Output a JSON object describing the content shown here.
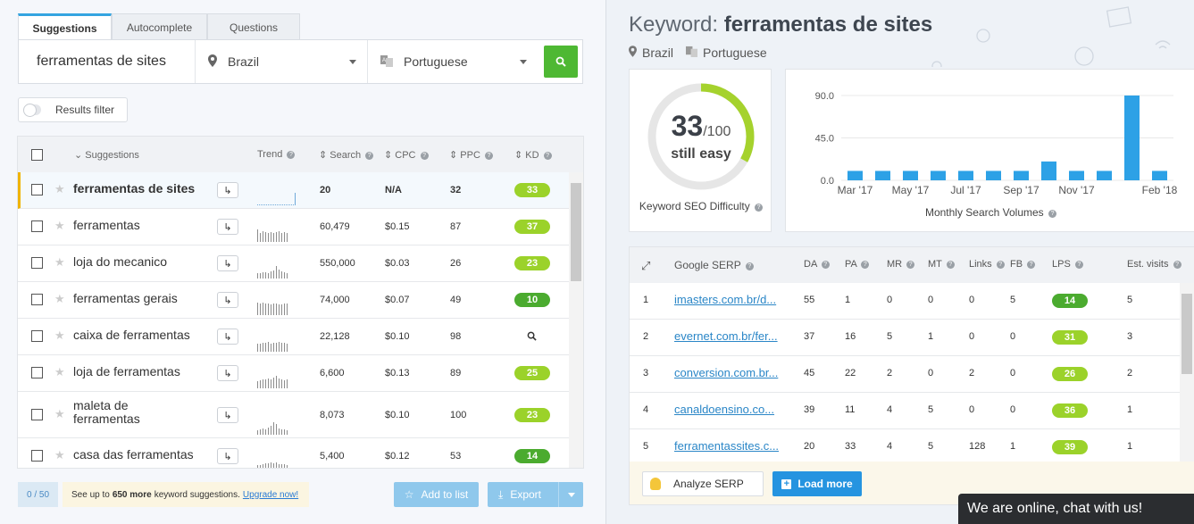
{
  "tabs": [
    "Suggestions",
    "Autocomplete",
    "Questions"
  ],
  "search": {
    "keyword": "ferramentas de sites",
    "location": "Brazil",
    "language": "Portuguese"
  },
  "filter_label": "Results filter",
  "columns": {
    "suggestions": "Suggestions",
    "trend": "Trend",
    "search": "Search",
    "cpc": "CPC",
    "ppc": "PPC",
    "kd": "KD"
  },
  "rows": [
    {
      "keyword": "ferramentas de sites",
      "search": "20",
      "cpc": "N/A",
      "ppc": "32",
      "kd": "33",
      "kd_color": "#9bd22a",
      "bold": true
    },
    {
      "keyword": "ferramentas",
      "search": "60,479",
      "cpc": "$0.15",
      "ppc": "87",
      "kd": "37",
      "kd_color": "#9bd22a"
    },
    {
      "keyword": "loja do mecanico",
      "search": "550,000",
      "cpc": "$0.03",
      "ppc": "26",
      "kd": "23",
      "kd_color": "#9bd22a"
    },
    {
      "keyword": "ferramentas gerais",
      "search": "74,000",
      "cpc": "$0.07",
      "ppc": "49",
      "kd": "10",
      "kd_color": "#4bab2f"
    },
    {
      "keyword": "caixa de ferramentas",
      "search": "22,128",
      "cpc": "$0.10",
      "ppc": "98",
      "kd": "",
      "kd_color": ""
    },
    {
      "keyword": "loja de ferramentas",
      "search": "6,600",
      "cpc": "$0.13",
      "ppc": "89",
      "kd": "25",
      "kd_color": "#9bd22a"
    },
    {
      "keyword": "maleta de ferramentas",
      "search": "8,073",
      "cpc": "$0.10",
      "ppc": "100",
      "kd": "23",
      "kd_color": "#9bd22a"
    },
    {
      "keyword": "casa das ferramentas",
      "search": "5,400",
      "cpc": "$0.12",
      "ppc": "53",
      "kd": "14",
      "kd_color": "#4bab2f"
    }
  ],
  "footer_left": {
    "counter": "0 / 50",
    "upsell_pre": "See up to",
    "upsell_bold": "650 more",
    "upsell_post": "keyword suggestions.",
    "upsell_link": "Upgrade now!",
    "add_to_list": "Add to list",
    "export": "Export"
  },
  "right": {
    "title_prefix": "Keyword:",
    "title_keyword": "ferramentas de sites",
    "location": "Brazil",
    "language": "Portuguese",
    "score": "33",
    "score_max": "/100",
    "score_label": "still easy",
    "score_caption": "Keyword SEO Difficulty",
    "volume_caption": "Monthly Search Volumes",
    "serp_header": {
      "google": "Google SERP",
      "da": "DA",
      "pa": "PA",
      "mr": "MR",
      "mt": "MT",
      "links": "Links",
      "fb": "FB",
      "lps": "LPS",
      "visits": "Est. visits"
    },
    "serp_rows": [
      {
        "n": "1",
        "url": "imasters.com.br/d...",
        "da": "55",
        "pa": "1",
        "mr": "0",
        "mt": "0",
        "links": "0",
        "fb": "5",
        "lps": "14",
        "lps_color": "#4bab2f",
        "visits": "5"
      },
      {
        "n": "2",
        "url": "evernet.com.br/fer...",
        "da": "37",
        "pa": "16",
        "mr": "5",
        "mt": "1",
        "links": "0",
        "fb": "0",
        "lps": "31",
        "lps_color": "#9bd22a",
        "visits": "3"
      },
      {
        "n": "3",
        "url": "conversion.com.br...",
        "da": "45",
        "pa": "22",
        "mr": "2",
        "mt": "0",
        "links": "2",
        "fb": "0",
        "lps": "26",
        "lps_color": "#9bd22a",
        "visits": "2"
      },
      {
        "n": "4",
        "url": "canaldoensino.co...",
        "da": "39",
        "pa": "11",
        "mr": "4",
        "mt": "5",
        "links": "0",
        "fb": "0",
        "lps": "36",
        "lps_color": "#9bd22a",
        "visits": "1"
      },
      {
        "n": "5",
        "url": "ferramentassites.c...",
        "da": "20",
        "pa": "33",
        "mr": "4",
        "mt": "5",
        "links": "128",
        "fb": "1",
        "lps": "39",
        "lps_color": "#9bd22a",
        "visits": "1"
      }
    ],
    "analyze_serp": "Analyze SERP",
    "load_more": "Load more"
  },
  "chat": "We are online, chat with us!",
  "chart_data": {
    "type": "bar",
    "categories": [
      "Mar '17",
      "Apr '17",
      "May '17",
      "Jun '17",
      "Jul '17",
      "Aug '17",
      "Sep '17",
      "Oct '17",
      "Nov '17",
      "Dec '17",
      "Jan '18",
      "Feb '18"
    ],
    "tick_labels": [
      "Mar '17",
      "May '17",
      "Jul '17",
      "Sep '17",
      "Nov '17",
      "Feb '18"
    ],
    "values": [
      10,
      10,
      10,
      10,
      10,
      10,
      10,
      20,
      10,
      10,
      90,
      10
    ],
    "yticks": [
      "0.0",
      "45.0",
      "90.0"
    ],
    "ylim": [
      0,
      90
    ],
    "color": "#2da1e6"
  }
}
